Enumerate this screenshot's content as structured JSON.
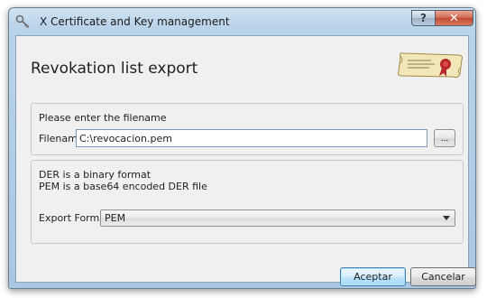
{
  "window": {
    "title": "X Certificate and Key management",
    "help_label": "?",
    "close_label": "✕",
    "app_icon": "key-icon"
  },
  "header": {
    "title": "Revokation list export",
    "graphic": "scroll-seal-icon"
  },
  "filename_group": {
    "prompt": "Please enter the filename",
    "field_label": "Filename",
    "field_value": "C:\\revocacion.pem",
    "browse_label": "..."
  },
  "format_group": {
    "info_line_1": "DER is a binary format",
    "info_line_2": "PEM is a base64 encoded DER file",
    "field_label": "Export Format",
    "selected": "PEM"
  },
  "buttons": {
    "ok_label": "Aceptar",
    "cancel_label": "Cancelar"
  },
  "colors": {
    "title_bar": "#b9d3ea",
    "dialog_bg": "#f0f0f0",
    "close_button": "#c24a33",
    "default_button_border": "#3c7fb1"
  }
}
